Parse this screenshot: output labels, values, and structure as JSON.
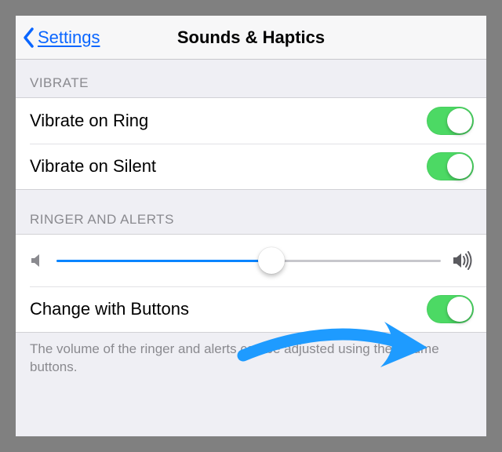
{
  "nav": {
    "back_label": "Settings",
    "title": "Sounds & Haptics"
  },
  "sections": {
    "vibrate": {
      "header": "VIBRATE",
      "rows": [
        {
          "label": "Vibrate on Ring",
          "on": true
        },
        {
          "label": "Vibrate on Silent",
          "on": true
        }
      ]
    },
    "ringer": {
      "header": "RINGER AND ALERTS",
      "volume_percent": 56,
      "change_label": "Change with Buttons",
      "change_on": true,
      "footer": "The volume of the ringer and alerts can be adjusted using the volume buttons."
    }
  },
  "colors": {
    "accent": "#007aff",
    "toggle_on": "#4cd964",
    "arrow": "#1e9bff"
  }
}
